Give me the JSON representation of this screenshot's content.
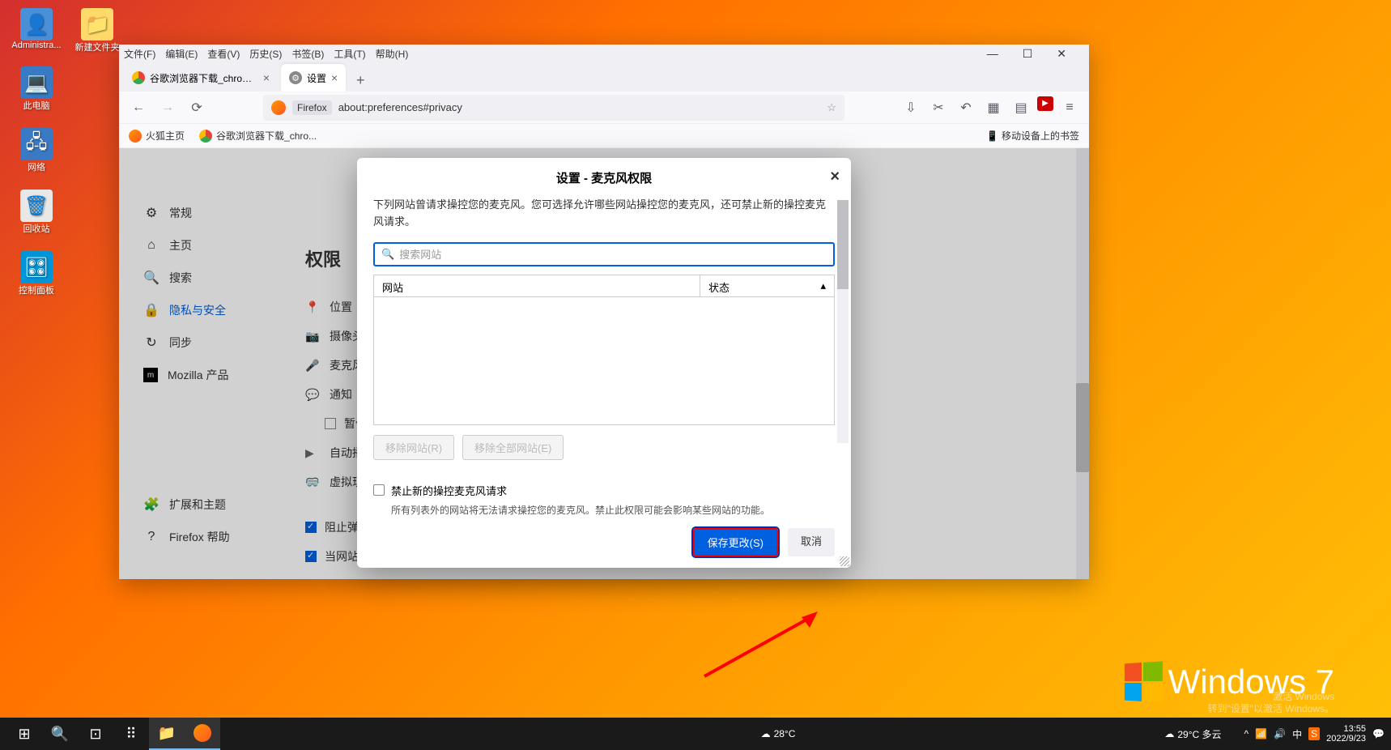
{
  "desktop": {
    "icons": [
      "Administra...",
      "新建文件夹",
      "此电脑",
      "网络",
      "回收站",
      "控制面板"
    ]
  },
  "window": {
    "menubar": [
      "文件(F)",
      "编辑(E)",
      "查看(V)",
      "历史(S)",
      "书签(B)",
      "工具(T)",
      "帮助(H)"
    ],
    "tabs": [
      {
        "title": "谷歌浏览器下载_chrome浏览器",
        "active": false
      },
      {
        "title": "设置",
        "active": true
      }
    ],
    "url": {
      "label": "Firefox",
      "path": "about:preferences#privacy"
    },
    "bookmarks": [
      {
        "label": "火狐主页"
      },
      {
        "label": "谷歌浏览器下载_chro..."
      }
    ],
    "bookmarks_right": "移动设备上的书签"
  },
  "settings": {
    "nav": [
      {
        "icon": "⚙",
        "label": "常规"
      },
      {
        "icon": "⌂",
        "label": "主页"
      },
      {
        "icon": "🔍",
        "label": "搜索"
      },
      {
        "icon": "🔒",
        "label": "隐私与安全",
        "active": true
      },
      {
        "icon": "↻",
        "label": "同步"
      },
      {
        "icon": "m",
        "label": "Mozilla 产品"
      }
    ],
    "nav_bottom": [
      {
        "icon": "🧩",
        "label": "扩展和主题"
      },
      {
        "icon": "?",
        "label": "Firefox 帮助"
      }
    ],
    "section_title": "权限",
    "rows": [
      {
        "icon": "📍",
        "label": "位置"
      },
      {
        "icon": "📷",
        "label": "摄像头"
      },
      {
        "icon": "🎤",
        "label": "麦克风"
      },
      {
        "icon": "💬",
        "label": "通知"
      },
      {
        "icon_cb": true,
        "label": "暂停"
      },
      {
        "icon": "▶",
        "label": "自动播"
      },
      {
        "icon": "🥽",
        "label": "虚拟现"
      }
    ],
    "checks": [
      {
        "checked": true,
        "label": "阻止弹"
      },
      {
        "checked": true,
        "label": "当网站"
      }
    ]
  },
  "modal": {
    "title": "设置 - 麦克风权限",
    "description": "下列网站曾请求操控您的麦克风。您可选择允许哪些网站操控您的麦克风，还可禁止新的操控麦克风请求。",
    "search_placeholder": "搜索网站",
    "col_site": "网站",
    "col_status": "状态",
    "remove_site": "移除网站(R)",
    "remove_all": "移除全部网站(E)",
    "block_new": "禁止新的操控麦克风请求",
    "block_note": "所有列表外的网站将无法请求操控您的麦克风。禁止此权限可能会影响某些网站的功能。",
    "save": "保存更改(S)",
    "cancel": "取消"
  },
  "win7": {
    "text": "Windows 7"
  },
  "activate": {
    "line1": "激活 Windows",
    "line2": "转到\"设置\"以激活 Windows。"
  },
  "taskbar": {
    "weather1": "28°C",
    "weather2": "29°C 多云",
    "ime": "中",
    "time": "13:55",
    "date": "2022/9/23"
  }
}
